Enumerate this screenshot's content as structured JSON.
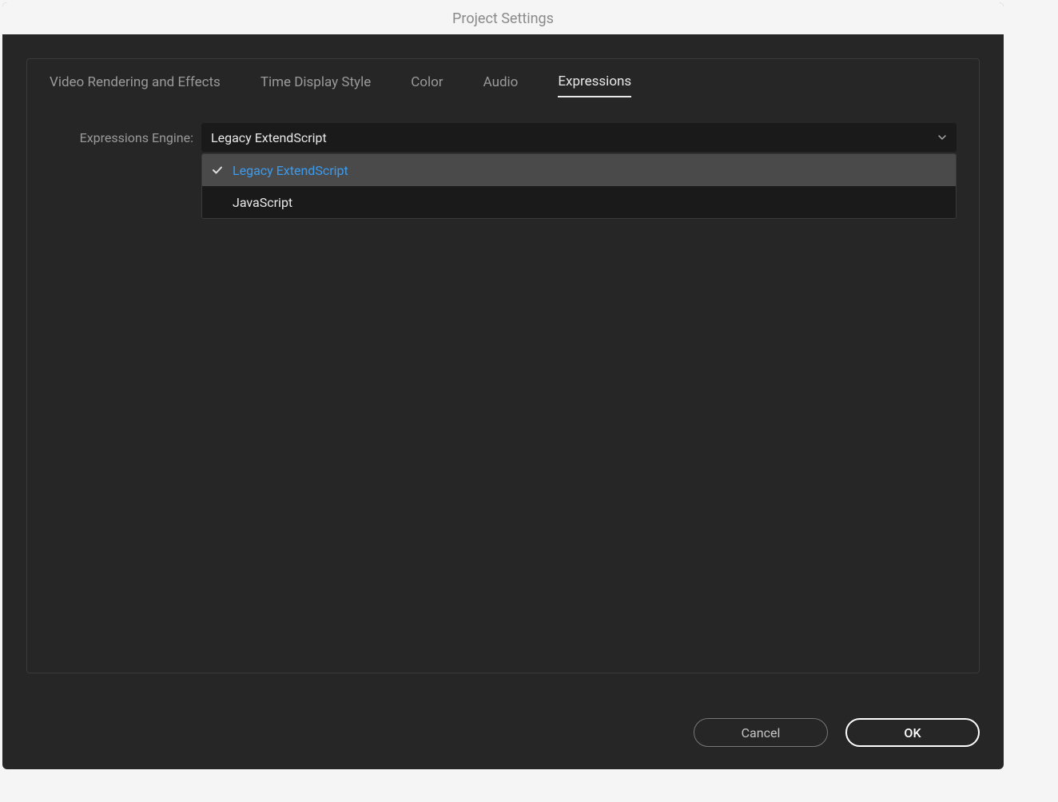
{
  "window": {
    "title": "Project Settings"
  },
  "tabs": [
    {
      "label": "Video Rendering and Effects",
      "active": false
    },
    {
      "label": "Time Display Style",
      "active": false
    },
    {
      "label": "Color",
      "active": false
    },
    {
      "label": "Audio",
      "active": false
    },
    {
      "label": "Expressions",
      "active": true
    }
  ],
  "form": {
    "expressions_engine_label": "Expressions Engine:",
    "dropdown": {
      "selected_value": "Legacy ExtendScript",
      "options": [
        {
          "label": "Legacy ExtendScript",
          "selected": true
        },
        {
          "label": "JavaScript",
          "selected": false
        }
      ]
    }
  },
  "buttons": {
    "cancel": "Cancel",
    "ok": "OK"
  }
}
